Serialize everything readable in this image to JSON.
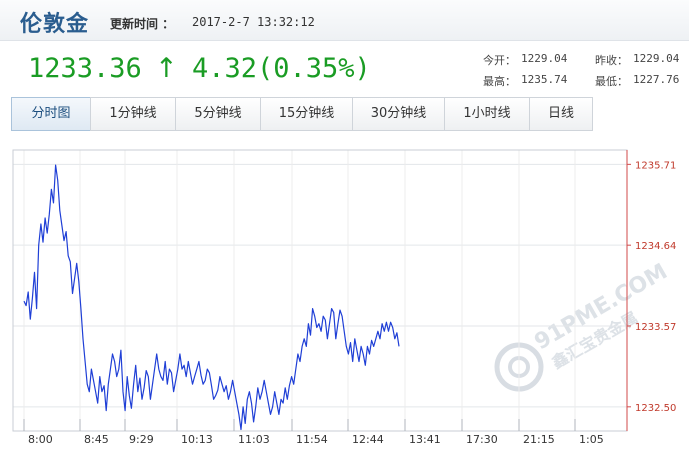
{
  "header": {
    "title": "伦敦金",
    "update_label": "更新时间 ：",
    "update_time": "2017-2-7 13:32:12"
  },
  "quote": {
    "price": "1233.36",
    "arrow": "↑",
    "change": "4.32(0.35%)",
    "open_label": "今开：",
    "open": "1229.04",
    "prev_close_label": "昨收：",
    "prev_close": "1229.04",
    "high_label": "最高：",
    "high": "1235.74",
    "low_label": "最低：",
    "low": "1227.76",
    "color": "#1a9c24"
  },
  "tabs": [
    {
      "label": "分时图",
      "active": true
    },
    {
      "label": "1分钟线",
      "active": false
    },
    {
      "label": "5分钟线",
      "active": false
    },
    {
      "label": "15分钟线",
      "active": false
    },
    {
      "label": "30分钟线",
      "active": false
    },
    {
      "label": "1小时线",
      "active": false
    },
    {
      "label": "日线",
      "active": false
    }
  ],
  "watermark": {
    "text": "91PME.COM",
    "subtext": "鑫汇宝贵金属"
  },
  "chart_data": {
    "type": "line",
    "x_ticks": [
      "8:00",
      "8:45",
      "9:29",
      "10:13",
      "11:03",
      "11:54",
      "12:44",
      "13:41",
      "17:30",
      "21:15",
      "1:05"
    ],
    "y_ticks": [
      "1235.71",
      "1234.64",
      "1233.57",
      "1232.50"
    ],
    "ylim": [
      1232.18,
      1235.9
    ],
    "grid": true,
    "line_color": "#1f3fd6",
    "series": [
      {
        "values": [
          1233.9,
          1233.84,
          1234.02,
          1233.66,
          1233.94,
          1234.28,
          1233.8,
          1234.64,
          1234.92,
          1234.68,
          1235.0,
          1234.8,
          1235.05,
          1235.38,
          1235.2,
          1235.7,
          1235.5,
          1235.1,
          1234.9,
          1234.7,
          1234.82,
          1234.5,
          1234.42,
          1234.0,
          1234.2,
          1234.4,
          1234.16,
          1233.8,
          1233.4,
          1233.1,
          1232.8,
          1232.7,
          1233.0,
          1232.85,
          1232.7,
          1232.55,
          1232.9,
          1232.7,
          1232.78,
          1232.45,
          1232.8,
          1233.0,
          1233.2,
          1233.1,
          1232.9,
          1233.0,
          1233.25,
          1232.7,
          1232.45,
          1232.9,
          1232.65,
          1232.48,
          1232.8,
          1233.05,
          1232.7,
          1232.88,
          1232.6,
          1232.75,
          1232.98,
          1232.9,
          1232.6,
          1232.8,
          1233.0,
          1233.2,
          1233.0,
          1232.9,
          1232.85,
          1233.1,
          1232.8,
          1233.0,
          1232.95,
          1232.7,
          1232.85,
          1233.0,
          1233.2,
          1233.0,
          1233.05,
          1232.9,
          1233.1,
          1232.95,
          1232.8,
          1232.9,
          1233.0,
          1233.1,
          1232.92,
          1232.8,
          1232.85,
          1233.0,
          1232.95,
          1232.78,
          1232.6,
          1232.65,
          1232.72,
          1232.9,
          1232.8,
          1232.7,
          1232.78,
          1232.6,
          1232.7,
          1232.85,
          1232.7,
          1232.55,
          1232.4,
          1232.2,
          1232.5,
          1232.28,
          1232.6,
          1232.7,
          1232.55,
          1232.3,
          1232.5,
          1232.75,
          1232.6,
          1232.7,
          1232.85,
          1232.7,
          1232.55,
          1232.4,
          1232.5,
          1232.7,
          1232.55,
          1232.4,
          1232.6,
          1232.55,
          1232.75,
          1232.6,
          1232.78,
          1232.9,
          1232.8,
          1233.0,
          1233.2,
          1233.1,
          1233.3,
          1233.4,
          1233.3,
          1233.6,
          1233.45,
          1233.8,
          1233.7,
          1233.55,
          1233.6,
          1233.5,
          1233.7,
          1233.65,
          1233.4,
          1233.6,
          1233.8,
          1233.75,
          1233.4,
          1233.6,
          1233.78,
          1233.7,
          1233.5,
          1233.3,
          1233.2,
          1233.35,
          1233.1,
          1233.4,
          1233.25,
          1233.1,
          1233.3,
          1233.2,
          1233.05,
          1233.3,
          1233.2,
          1233.38,
          1233.3,
          1233.4,
          1233.5,
          1233.4,
          1233.6,
          1233.5,
          1233.62,
          1233.5,
          1233.62,
          1233.55,
          1233.4,
          1233.48,
          1233.3
        ]
      }
    ]
  }
}
